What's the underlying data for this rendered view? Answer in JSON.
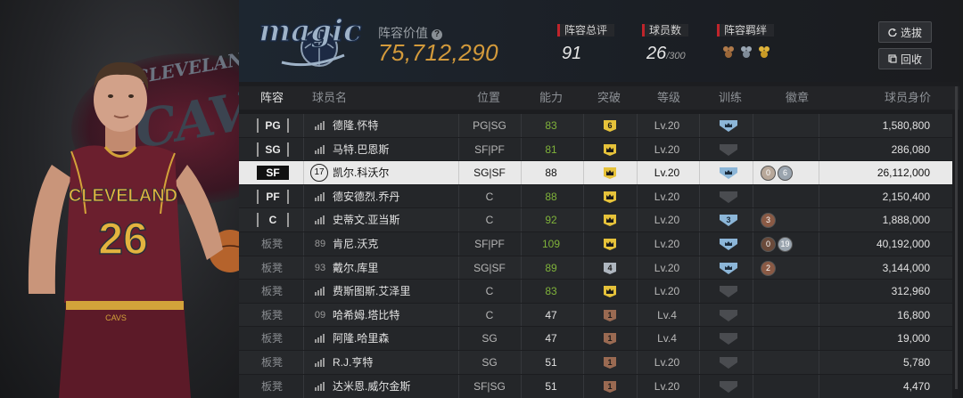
{
  "header": {
    "value_label": "阵容价值",
    "value": "75,712,290",
    "rating_label": "阵容总评",
    "rating": "91",
    "players_label": "球员数",
    "players": "26",
    "players_max": "/300",
    "synergy_label": "阵容羁绊",
    "btn_select": "选拔",
    "btn_recycle": "回收"
  },
  "columns": {
    "lineup": "阵容",
    "name": "球员名",
    "position": "位置",
    "ability": "能力",
    "breakthrough": "突破",
    "level": "等级",
    "training": "训练",
    "badge": "徽章",
    "price": "球员身价"
  },
  "player_card": {
    "team_text": "CLEVELAND",
    "number": "26",
    "bg_text": "CAVALIER",
    "bg_text2": "CLEVELAND"
  },
  "team_logo_text": "magic",
  "colors": {
    "accent": "#d39a3b",
    "ability_green": "#7fb23a",
    "red_marker": "#c0242b"
  },
  "rows": [
    {
      "slot": "PG",
      "num": "",
      "name": "德隆.怀特",
      "position": "PG|SG",
      "ability": "83",
      "green": true,
      "brk": "6",
      "brk_type": "gold",
      "level": "Lv.20",
      "train": "blue",
      "badges": [],
      "price": "1,580,800"
    },
    {
      "slot": "SG",
      "num": "",
      "name": "马特.巴恩斯",
      "position": "SF|PF",
      "ability": "81",
      "green": true,
      "brk": "crown",
      "brk_type": "gold",
      "level": "Lv.20",
      "train": "grey",
      "badges": [],
      "price": "286,080"
    },
    {
      "slot": "SF",
      "num": "17",
      "name": "凯尔.科沃尔",
      "position": "SG|SF",
      "ability": "88",
      "green": false,
      "brk": "crown",
      "brk_type": "gold",
      "level": "Lv.20",
      "train": "blue",
      "badges": [
        {
          "t": "0",
          "c": "#b8a89a"
        },
        {
          "t": "6",
          "c": "#9aa4ae"
        }
      ],
      "price": "26,112,000",
      "selected": true
    },
    {
      "slot": "PF",
      "num": "",
      "name": "德安德烈.乔丹",
      "position": "C",
      "ability": "88",
      "green": true,
      "brk": "crown",
      "brk_type": "gold",
      "level": "Lv.20",
      "train": "grey",
      "badges": [],
      "price": "2,150,400"
    },
    {
      "slot": "C",
      "num": "",
      "name": "史蒂文.亚当斯",
      "position": "C",
      "ability": "92",
      "green": true,
      "brk": "crown",
      "brk_type": "gold",
      "level": "Lv.20",
      "train": "blue3",
      "badges": [
        {
          "t": "3",
          "c": "#8a5a45"
        }
      ],
      "price": "1,888,000"
    },
    {
      "slot": "板凳",
      "num": "89",
      "name": "肯尼.沃克",
      "position": "SF|PF",
      "ability": "109",
      "green": true,
      "brk": "crown",
      "brk_type": "gold",
      "level": "Lv.20",
      "train": "blue",
      "badges": [
        {
          "t": "0",
          "c": "#6a4a3a"
        },
        {
          "t": "19",
          "c": "#9aa4ae"
        }
      ],
      "price": "40,192,000"
    },
    {
      "slot": "板凳",
      "num": "93",
      "name": "戴尔.库里",
      "position": "SG|SF",
      "ability": "89",
      "green": true,
      "brk": "4",
      "brk_type": "silver",
      "level": "Lv.20",
      "train": "blue",
      "badges": [
        {
          "t": "2",
          "c": "#8a5a45"
        }
      ],
      "price": "3,144,000"
    },
    {
      "slot": "板凳",
      "num": "",
      "name": "费斯图斯.艾泽里",
      "position": "C",
      "ability": "83",
      "green": true,
      "brk": "crown",
      "brk_type": "gold",
      "level": "Lv.20",
      "train": "grey",
      "badges": [],
      "price": "312,960"
    },
    {
      "slot": "板凳",
      "num": "09",
      "name": "哈希姆.塔比特",
      "position": "C",
      "ability": "47",
      "green": false,
      "brk": "1",
      "brk_type": "bronze",
      "level": "Lv.4",
      "train": "grey",
      "badges": [],
      "price": "16,800"
    },
    {
      "slot": "板凳",
      "num": "",
      "name": "阿隆.哈里森",
      "position": "SG",
      "ability": "47",
      "green": false,
      "brk": "1",
      "brk_type": "bronze",
      "level": "Lv.4",
      "train": "grey",
      "badges": [],
      "price": "19,000"
    },
    {
      "slot": "板凳",
      "num": "",
      "name": "R.J.亨特",
      "position": "SG",
      "ability": "51",
      "green": false,
      "brk": "1",
      "brk_type": "bronze",
      "level": "Lv.20",
      "train": "grey",
      "badges": [],
      "price": "5,780"
    },
    {
      "slot": "板凳",
      "num": "",
      "name": "达米恩.威尔金斯",
      "position": "SF|SG",
      "ability": "51",
      "green": false,
      "brk": "1",
      "brk_type": "bronze",
      "level": "Lv.20",
      "train": "grey",
      "badges": [],
      "price": "4,470"
    }
  ]
}
